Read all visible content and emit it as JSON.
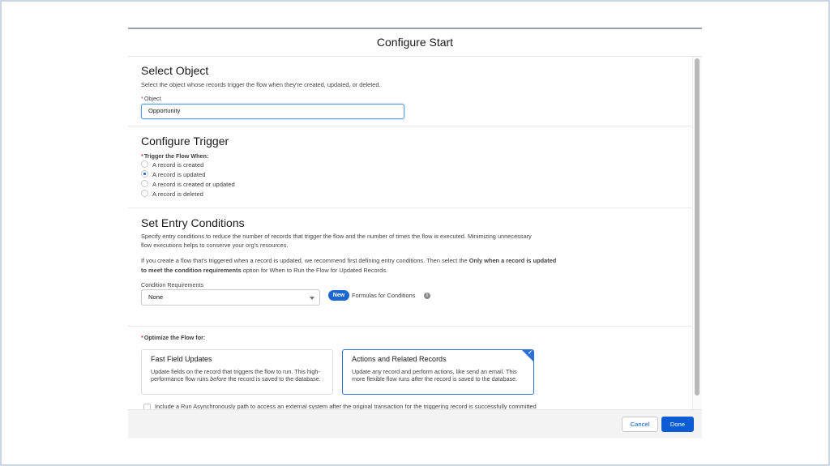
{
  "modal": {
    "title": "Configure Start"
  },
  "select_object": {
    "title": "Select Object",
    "description": "Select the object whose records trigger the flow when they're created, updated, or deleted.",
    "object_label": "Object",
    "object_value": "Opportunity"
  },
  "configure_trigger": {
    "title": "Configure Trigger",
    "label": "Trigger the Flow When:",
    "options": [
      {
        "label": "A record is created",
        "checked": false
      },
      {
        "label": "A record is updated",
        "checked": true
      },
      {
        "label": "A record is created or updated",
        "checked": false
      },
      {
        "label": "A record is deleted",
        "checked": false
      }
    ]
  },
  "entry_conditions": {
    "title": "Set Entry Conditions",
    "description_line1": "Specify entry conditions to reduce the number of records that trigger the flow and the number of times the flow is executed. Minimizing unnecessary",
    "description_line2": "flow executions helps to conserve your org's resources.",
    "recommend_prefix": "If you create a flow that's triggered when a record is updated, we recommend first defining entry conditions. Then select the ",
    "recommend_bold_1": "Only when a record is",
    "recommend_bold_2": "updated to meet the condition requirements",
    "recommend_suffix": " option for When to Run the Flow for Updated Records.",
    "condition_label": "Condition Requirements",
    "condition_value": "None",
    "new_badge": "New",
    "formulas_label": "Formulas for Conditions",
    "info_icon": "i"
  },
  "optimize": {
    "label": "Optimize the Flow for:",
    "cards": [
      {
        "title": "Fast Field Updates",
        "desc_pre": "Update fields on the record that triggers the flow to run. This high-performance flow runs ",
        "desc_em": "before",
        "desc_post": " the record is saved to the database.",
        "selected": false
      },
      {
        "title": "Actions and Related Records",
        "desc_pre": "Update any record and perform actions, like send an email. This more flexible flow runs ",
        "desc_em": "after",
        "desc_post": " the record is saved to the database.",
        "selected": true
      }
    ],
    "async_checkbox_label": "Include a Run Asynchronously path to access an external system after the original transaction for the triggering record is successfully committed",
    "async_checked": false
  },
  "footer": {
    "cancel_label": "Cancel",
    "done_label": "Done"
  },
  "colors": {
    "brand_blue": "#0b5cd5",
    "required_red": "#c23934"
  }
}
